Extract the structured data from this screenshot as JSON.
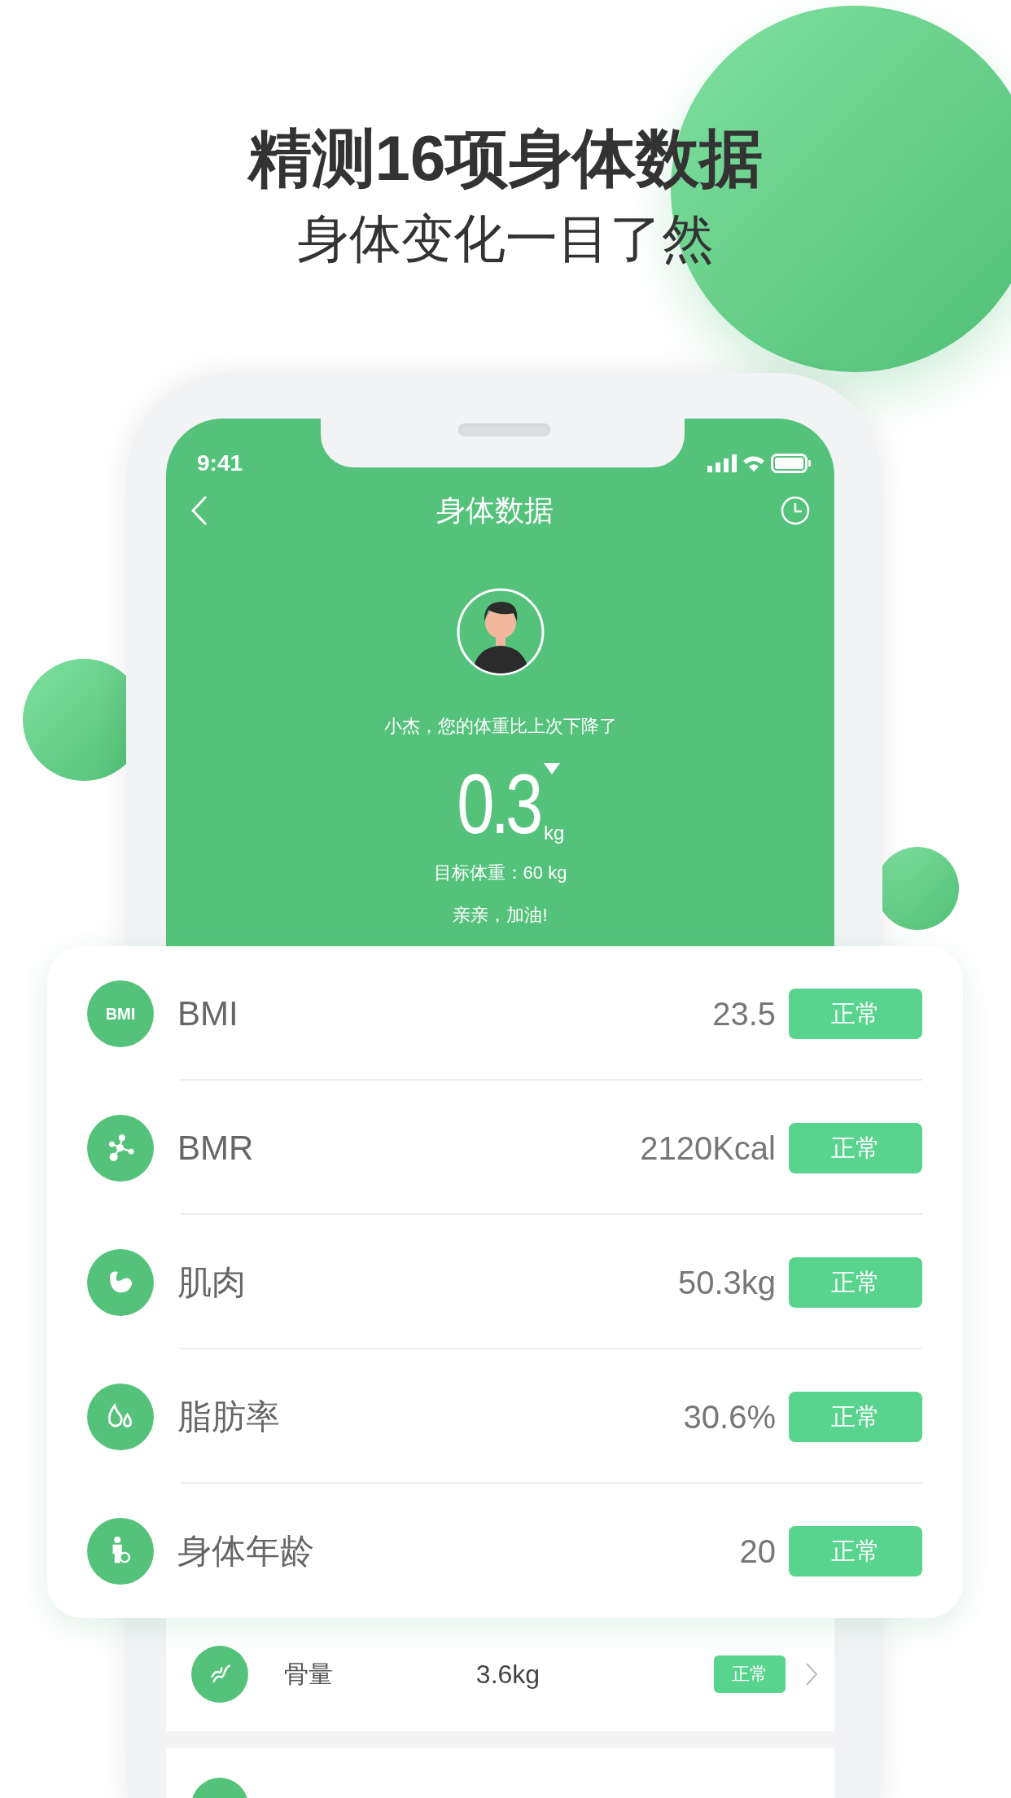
{
  "headline": "精测16项身体数据",
  "subheadline": "身体变化一目了然",
  "status_bar": {
    "time": "9:41"
  },
  "nav": {
    "title": "身体数据"
  },
  "profile": {
    "message": "小杰，您的体重比上次下降了",
    "change": "0.3",
    "unit": "kg",
    "falling": true,
    "goal": "目标体重：60 kg",
    "cheer": "亲亲，加油!"
  },
  "card_rows": [
    {
      "icon_text": "BMI",
      "label": "BMI",
      "value": "23.5",
      "status": "正常"
    },
    {
      "label": "BMR",
      "value": "2120Kcal",
      "status": "正常"
    },
    {
      "label": "肌肉",
      "value": "50.3kg",
      "status": "正常"
    },
    {
      "label": "脂肪率",
      "value": "30.6%",
      "status": "正常"
    },
    {
      "label": "身体年龄",
      "value": "20",
      "status": "正常"
    }
  ],
  "list_rows": [
    {
      "kind": "full",
      "label": "骨量",
      "value": "3.6kg",
      "status": "正常"
    },
    {
      "kind": "cut"
    }
  ]
}
